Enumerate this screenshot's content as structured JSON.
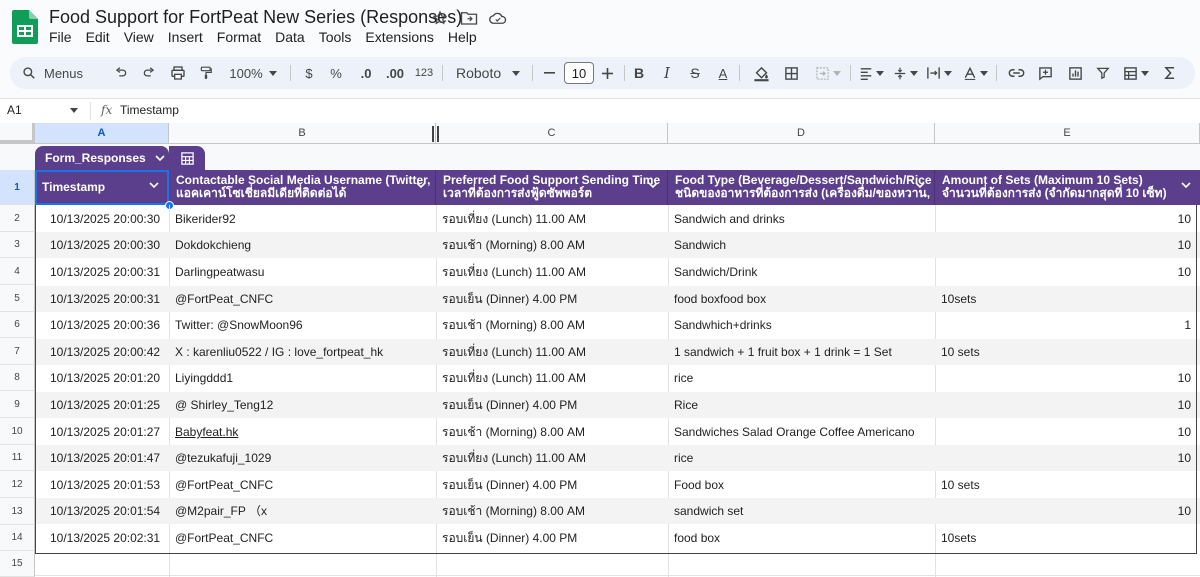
{
  "doc": {
    "title": "Food Support for FortPeat New Series  (Responses)"
  },
  "menu": [
    "File",
    "Edit",
    "View",
    "Insert",
    "Format",
    "Data",
    "Tools",
    "Extensions",
    "Help"
  ],
  "toolbar": {
    "menus_label": "Menus",
    "zoom": "100%",
    "currency": "$",
    "percent": "%",
    "dec_decrease": ".0",
    "dec_increase": ".00",
    "number_format": "123",
    "font": "Roboto",
    "font_size": "10",
    "bold": "B",
    "italic": "I",
    "strike": "S",
    "text_color": "A"
  },
  "formula_bar": {
    "cell_ref": "A1",
    "fx": "fx",
    "value": "Timestamp"
  },
  "columns": [
    "A",
    "B",
    "C",
    "D",
    "E"
  ],
  "table": {
    "name": "Form_Responses"
  },
  "headers": [
    {
      "line1": "Timestamp",
      "line2": ""
    },
    {
      "line1": "Contactable Social Media Username (Twitter,",
      "line2": "แอคเคาน์โซเชี่ยลมีเดียที่ติดต่อได้"
    },
    {
      "line1": "Preferred Food Support Sending Time",
      "line2": "เวลาที่ต้องการส่งฟู้ดซัพพอร์ต"
    },
    {
      "line1": "Food Type (Beverage/Dessert/Sandwich/Rice",
      "line2": "ชนิดของอาหารที่ต้องการส่ง (เครื่องดื่ม/ของหวาน,"
    },
    {
      "line1": "Amount of Sets (Maximum 10 Sets)",
      "line2": "จำนวนที่ต้องการส่ง (จำกัดมากสุดที่ 10 เซ็ท)"
    }
  ],
  "row_numbers": [
    "1",
    "2",
    "3",
    "4",
    "5",
    "6",
    "7",
    "8",
    "9",
    "10",
    "11",
    "12",
    "13",
    "14",
    "15"
  ],
  "rows": [
    {
      "timestamp": "10/13/2025 20:00:30",
      "username": "Bikerider92",
      "time": "รอบเที่ยง (Lunch) 11.00 AM",
      "food": "Sandwich and drinks",
      "amount_text": "",
      "amount_num": "10"
    },
    {
      "timestamp": "10/13/2025 20:00:30",
      "username": "Dokdokchieng",
      "time": "รอบเช้า (Morning) 8.00 AM",
      "food": "Sandwich",
      "amount_text": "",
      "amount_num": "10"
    },
    {
      "timestamp": "10/13/2025 20:00:31",
      "username": "Darlingpeatwasu",
      "time": "รอบเที่ยง (Lunch) 11.00 AM",
      "food": "Sandwich/Drink",
      "amount_text": "",
      "amount_num": "10"
    },
    {
      "timestamp": "10/13/2025 20:00:31",
      "username": "@FortPeat_CNFC",
      "time": "รอบเย็น (Dinner) 4.00 PM",
      "food": "food boxfood box",
      "amount_text": "10sets",
      "amount_num": ""
    },
    {
      "timestamp": "10/13/2025 20:00:36",
      "username": "Twitter: @SnowMoon96",
      "time": "รอบเช้า (Morning) 8.00 AM",
      "food": "Sandwhich+drinks",
      "amount_text": "",
      "amount_num": "1"
    },
    {
      "timestamp": "10/13/2025 20:00:42",
      "username": "X : karenliu0522 / IG : love_fortpeat_hk",
      "time": "รอบเที่ยง (Lunch) 11.00 AM",
      "food": "1 sandwich + 1 fruit box + 1 drink = 1 Set",
      "amount_text": "10 sets",
      "amount_num": ""
    },
    {
      "timestamp": "10/13/2025 20:01:20",
      "username": "Liyingddd1",
      "time": "รอบเที่ยง (Lunch) 11.00 AM",
      "food": "rice",
      "amount_text": "",
      "amount_num": "10"
    },
    {
      "timestamp": "10/13/2025 20:01:25",
      "username": "@ Shirley_Teng12",
      "time": "รอบเย็น (Dinner) 4.00 PM",
      "food": "Rice",
      "amount_text": "",
      "amount_num": "10"
    },
    {
      "timestamp": "10/13/2025 20:01:27",
      "username": "Babyfeat.hk",
      "username_link": true,
      "time": "รอบเช้า (Morning) 8.00 AM",
      "food": "Sandwiches Salad Orange Coffee Americano",
      "amount_text": "",
      "amount_num": "10"
    },
    {
      "timestamp": "10/13/2025 20:01:47",
      "username": "@tezukafuji_1029",
      "time": "รอบเที่ยง (Lunch) 11.00 AM",
      "food": "rice",
      "amount_text": "",
      "amount_num": "10"
    },
    {
      "timestamp": "10/13/2025 20:01:53",
      "username": "@FortPeat_CNFC",
      "time": "รอบเย็น (Dinner) 4.00 PM",
      "food": "Food box",
      "amount_text": "10 sets",
      "amount_num": ""
    },
    {
      "timestamp": "10/13/2025 20:01:54",
      "username": "@M2pair_FP （x",
      "time": "รอบเช้า (Morning) 8.00 AM",
      "food": "sandwich set",
      "amount_text": "",
      "amount_num": "10"
    },
    {
      "timestamp": "10/13/2025 20:02:31",
      "username": "@FortPeat_CNFC",
      "time": "รอบเย็น (Dinner) 4.00 PM",
      "food": "food box",
      "amount_text": "10sets",
      "amount_num": ""
    }
  ],
  "colors": {
    "header_purple": "#5b3f8c",
    "selection_blue": "#1a73e8",
    "sheets_green": "#0f9d58"
  }
}
